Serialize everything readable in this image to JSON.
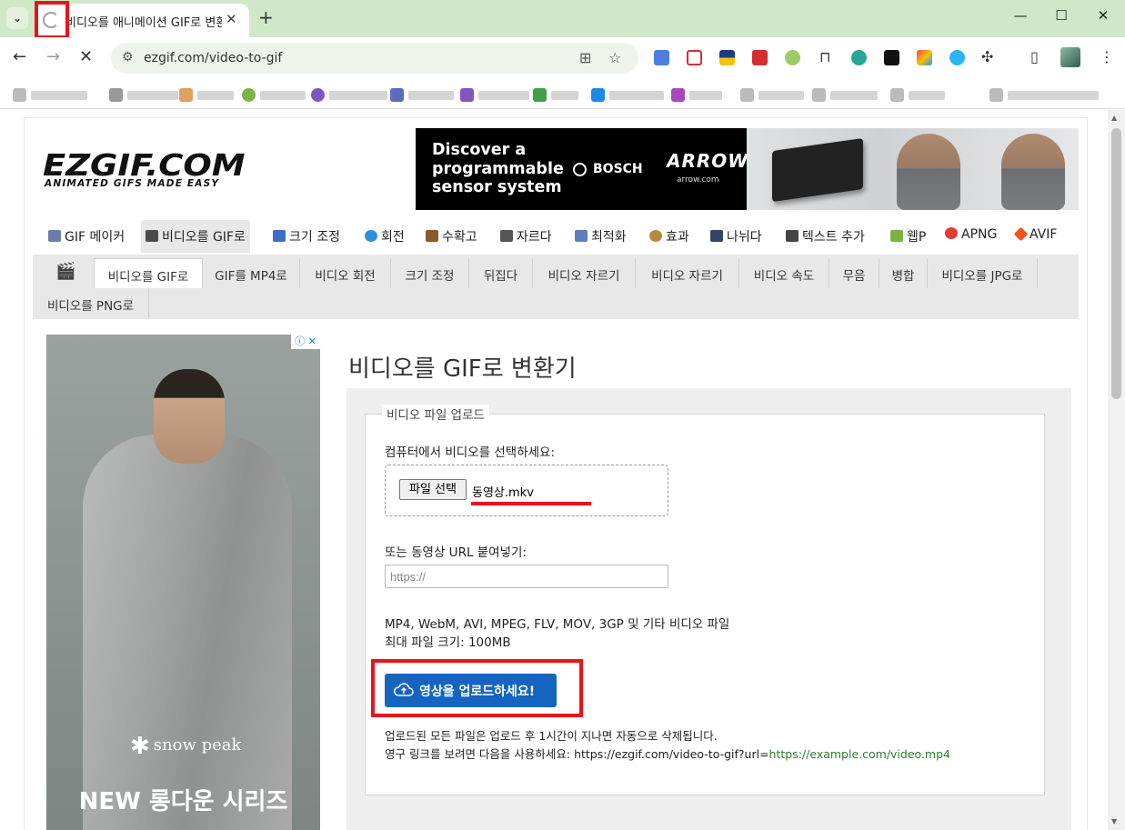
{
  "browser": {
    "tab_title": "비디오를 애니메이션 GIF로 변환",
    "new_tab_label": "+",
    "url": "ezgif.com/video-to-gif",
    "tab_list_icon": "chevron-down-icon",
    "window_controls": {
      "minimize": "—",
      "maximize": "☐",
      "close": "✕"
    }
  },
  "site": {
    "logo": "EZGIF.COM",
    "tagline": "ANIMATED GIFS MADE EASY"
  },
  "banner_ad": {
    "headline": "Discover a programmable sensor system",
    "bosch": "BOSCH",
    "arrow": "ARROW",
    "arrow_url": "arrow.com"
  },
  "main_nav": [
    {
      "label": "GIF 메이커",
      "icon": "gif-maker-icon",
      "color": "#6a7fa8"
    },
    {
      "label": "비디오를 GIF로",
      "icon": "film-icon",
      "color": "#4a4a4a"
    },
    {
      "label": "크기 조정",
      "icon": "resize-icon",
      "color": "#3c6ec4"
    },
    {
      "label": "회전",
      "icon": "rotate-icon",
      "color": "#2f8fd8"
    },
    {
      "label": "수확고",
      "icon": "crop-icon",
      "color": "#8a5a2a"
    },
    {
      "label": "자르다",
      "icon": "cut-icon",
      "color": "#555555"
    },
    {
      "label": "최적화",
      "icon": "optimize-icon",
      "color": "#5b7dbb"
    },
    {
      "label": "효과",
      "icon": "effects-icon",
      "color": "#b88a3c"
    },
    {
      "label": "나뉘다",
      "icon": "split-icon",
      "color": "#334466"
    },
    {
      "label": "텍스트 추가",
      "icon": "text-icon",
      "color": "#444444"
    },
    {
      "label": "웹P",
      "icon": "webp-icon",
      "color": "#7cb342"
    },
    {
      "label": "APNG",
      "icon": "apng-icon",
      "color": "#e53935"
    },
    {
      "label": "AVIF",
      "icon": "avif-icon",
      "color": "#f4511e"
    }
  ],
  "sub_nav": [
    "비디오를 GIF로",
    "GIF를 MP4로",
    "비디오 회전",
    "크기 조정",
    "뒤집다",
    "비디오 자르기",
    "비디오 자르기",
    "비디오 속도",
    "무음",
    "병합",
    "비디오를 JPG로",
    "비디오를 PNG로"
  ],
  "left_ad": {
    "brand": "snow peak",
    "headline": "NEW 롱다운 시리즈"
  },
  "converter": {
    "heading": "비디오를 GIF로 변환기",
    "legend": "비디오 파일 업로드",
    "select_label": "컴퓨터에서 비디오를 선택하세요:",
    "file_button": "파일 선택",
    "file_name": "동영상.mkv",
    "url_label": "또는 동영상 URL 붙여넣기:",
    "url_placeholder": "https://",
    "formats": "MP4, WebM, AVI, MPEG, FLV, MOV, 3GP 및 기타 비디오 파일",
    "max_size": "최대 파일 크기: 100MB",
    "upload_button": "영상을 업로드하세요!",
    "note1": "업로드된 모든 파일은 업로드 후 1시간이 지나면 자동으로 삭제됩니다.",
    "note2_prefix": "영구 링크를 보려면 다음을 사용하세요: https://ezgif.com/video-to-gif?url=",
    "note2_link": "https://example.com/video.mp4"
  },
  "colors": {
    "tabstrip": "#cfe9c8",
    "highlight_red": "#e8141c",
    "upload_button": "#1565c0",
    "link_green": "#2e7d32"
  }
}
